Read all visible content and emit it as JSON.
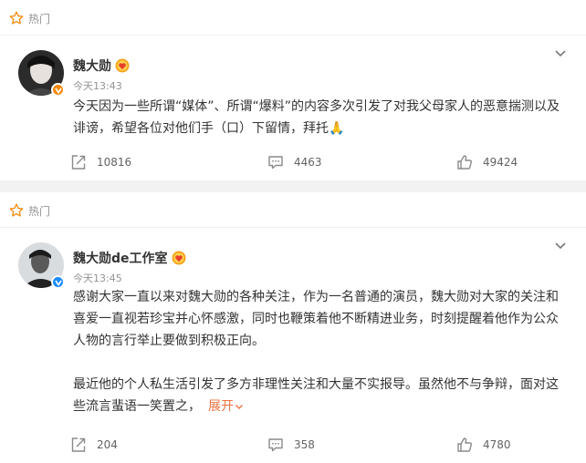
{
  "colors": {
    "accent": "#eb7340",
    "verified_orange": "#f5890f",
    "verified_blue": "#1a8cff",
    "muted": "#939393"
  },
  "posts": [
    {
      "tag": "热门",
      "username": "魏大勋",
      "time": "今天13:43",
      "paragraphs": [
        "今天因为一些所谓“媒体”、所谓“爆料”的内容多次引发了对我父母家人的恶意揣测以及诽谤，希望各位对他们手（口）下留情，拜托🙏"
      ],
      "reposts": "10816",
      "comments": "4463",
      "likes": "49424",
      "verified_icon": "orange-v-icon"
    },
    {
      "tag": "热门",
      "username": "魏大勋de工作室",
      "time": "今天13:45",
      "paragraphs": [
        "感谢大家一直以来对魏大勋的各种关注，作为一名普通的演员，魏大勋对大家的关注和喜爱一直视若珍宝并心怀感激，同时也鞭策着他不断精进业务，时刻提醒着他作为公众人物的言行举止要做到积极正向。",
        "最近他的个人私生活引发了多方非理性关注和大量不实报导。虽然他不与争辩，面对这些流言蜚语一笑置之，"
      ],
      "expand_label": "展开",
      "reposts": "204",
      "comments": "358",
      "likes": "4780",
      "verified_icon": "blue-v-icon"
    }
  ]
}
